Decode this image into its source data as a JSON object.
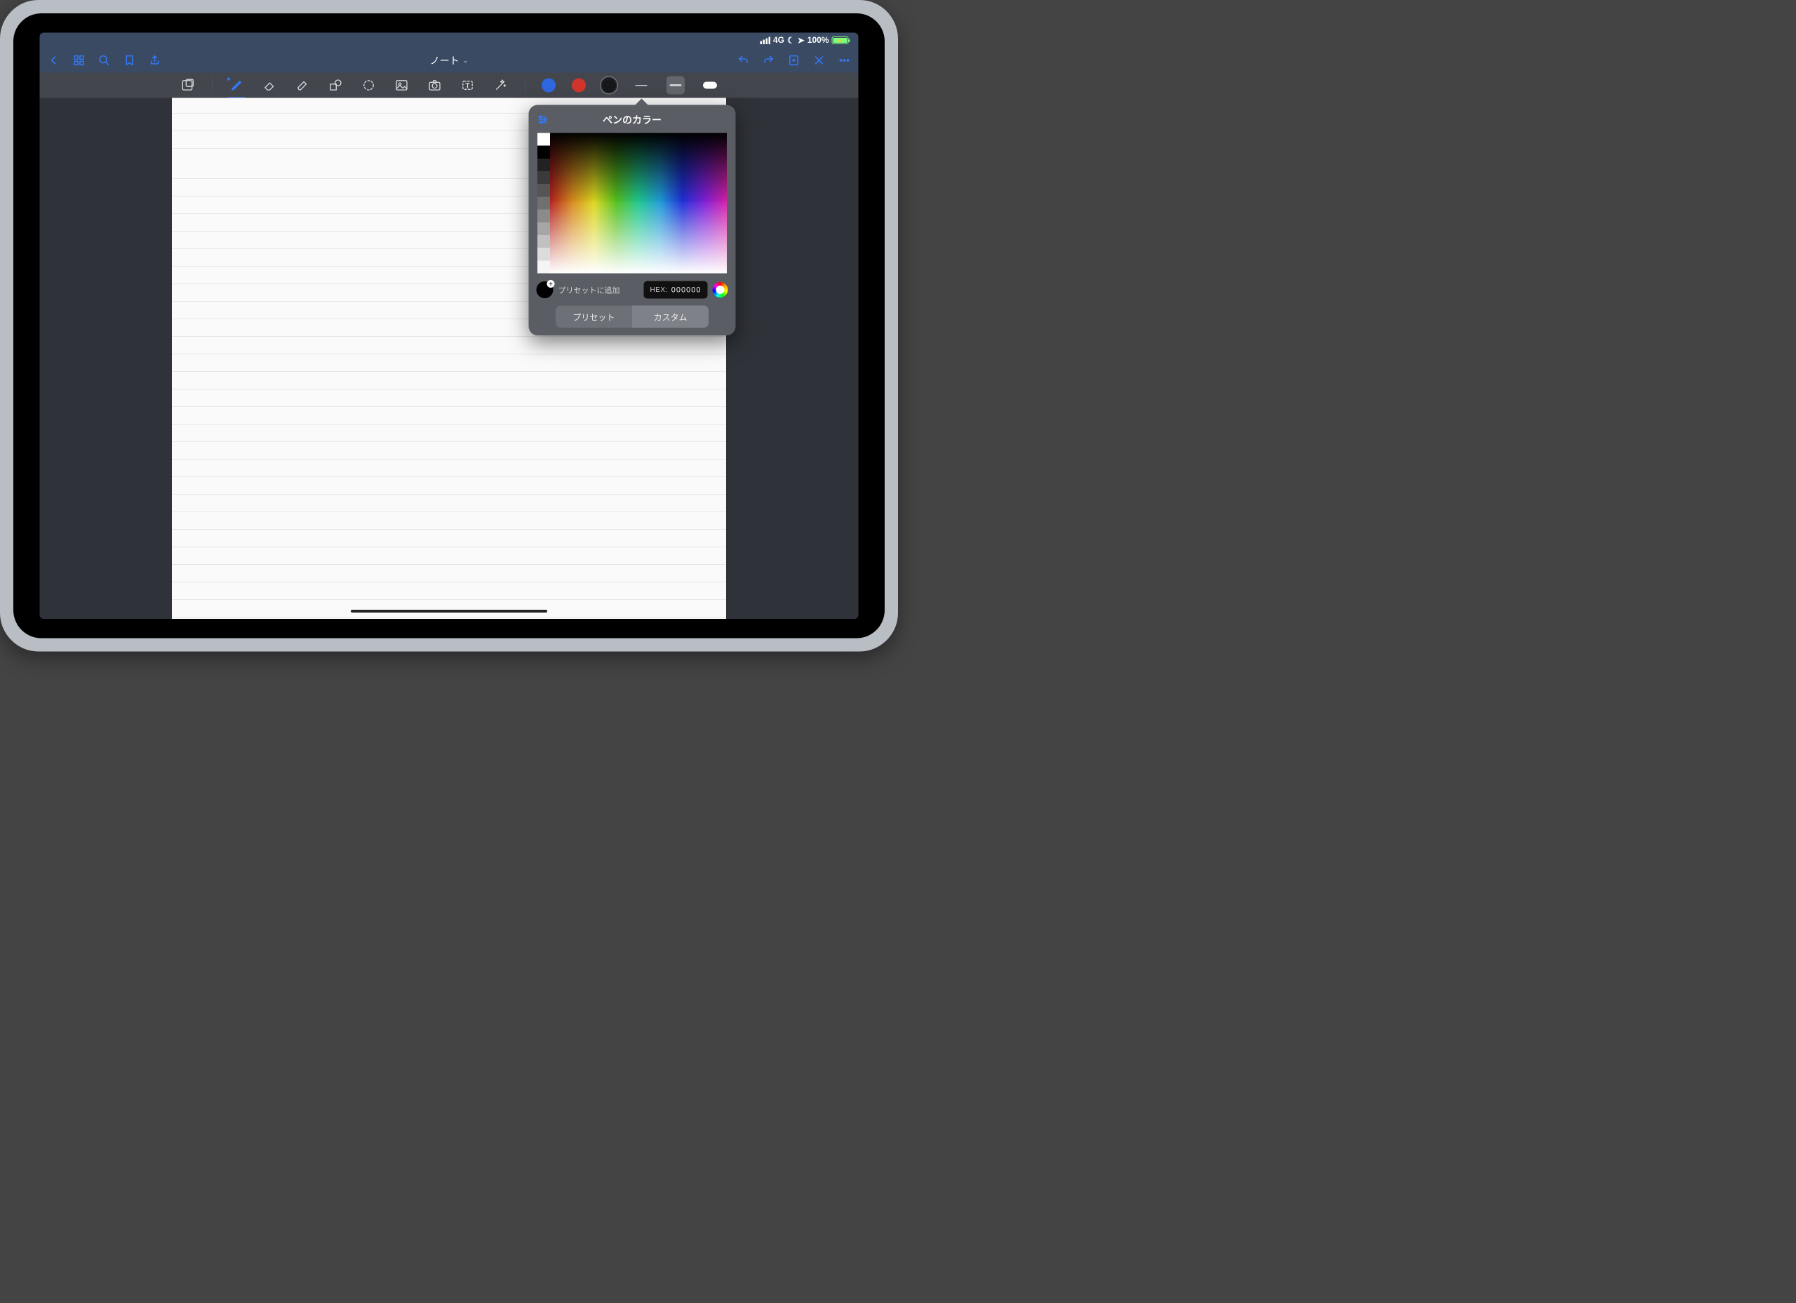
{
  "status": {
    "network": "4G",
    "battery": "100%"
  },
  "header": {
    "title": "ノート"
  },
  "colors": {
    "blue": "#2f68de",
    "red": "#d0342c",
    "black": "#15171b"
  },
  "popover": {
    "title": "ペンのカラー",
    "add_preset": "プリセットに追加",
    "hex_label": "HEX:",
    "hex_value": "000000",
    "tab_preset": "プリセット",
    "tab_custom": "カスタム"
  }
}
